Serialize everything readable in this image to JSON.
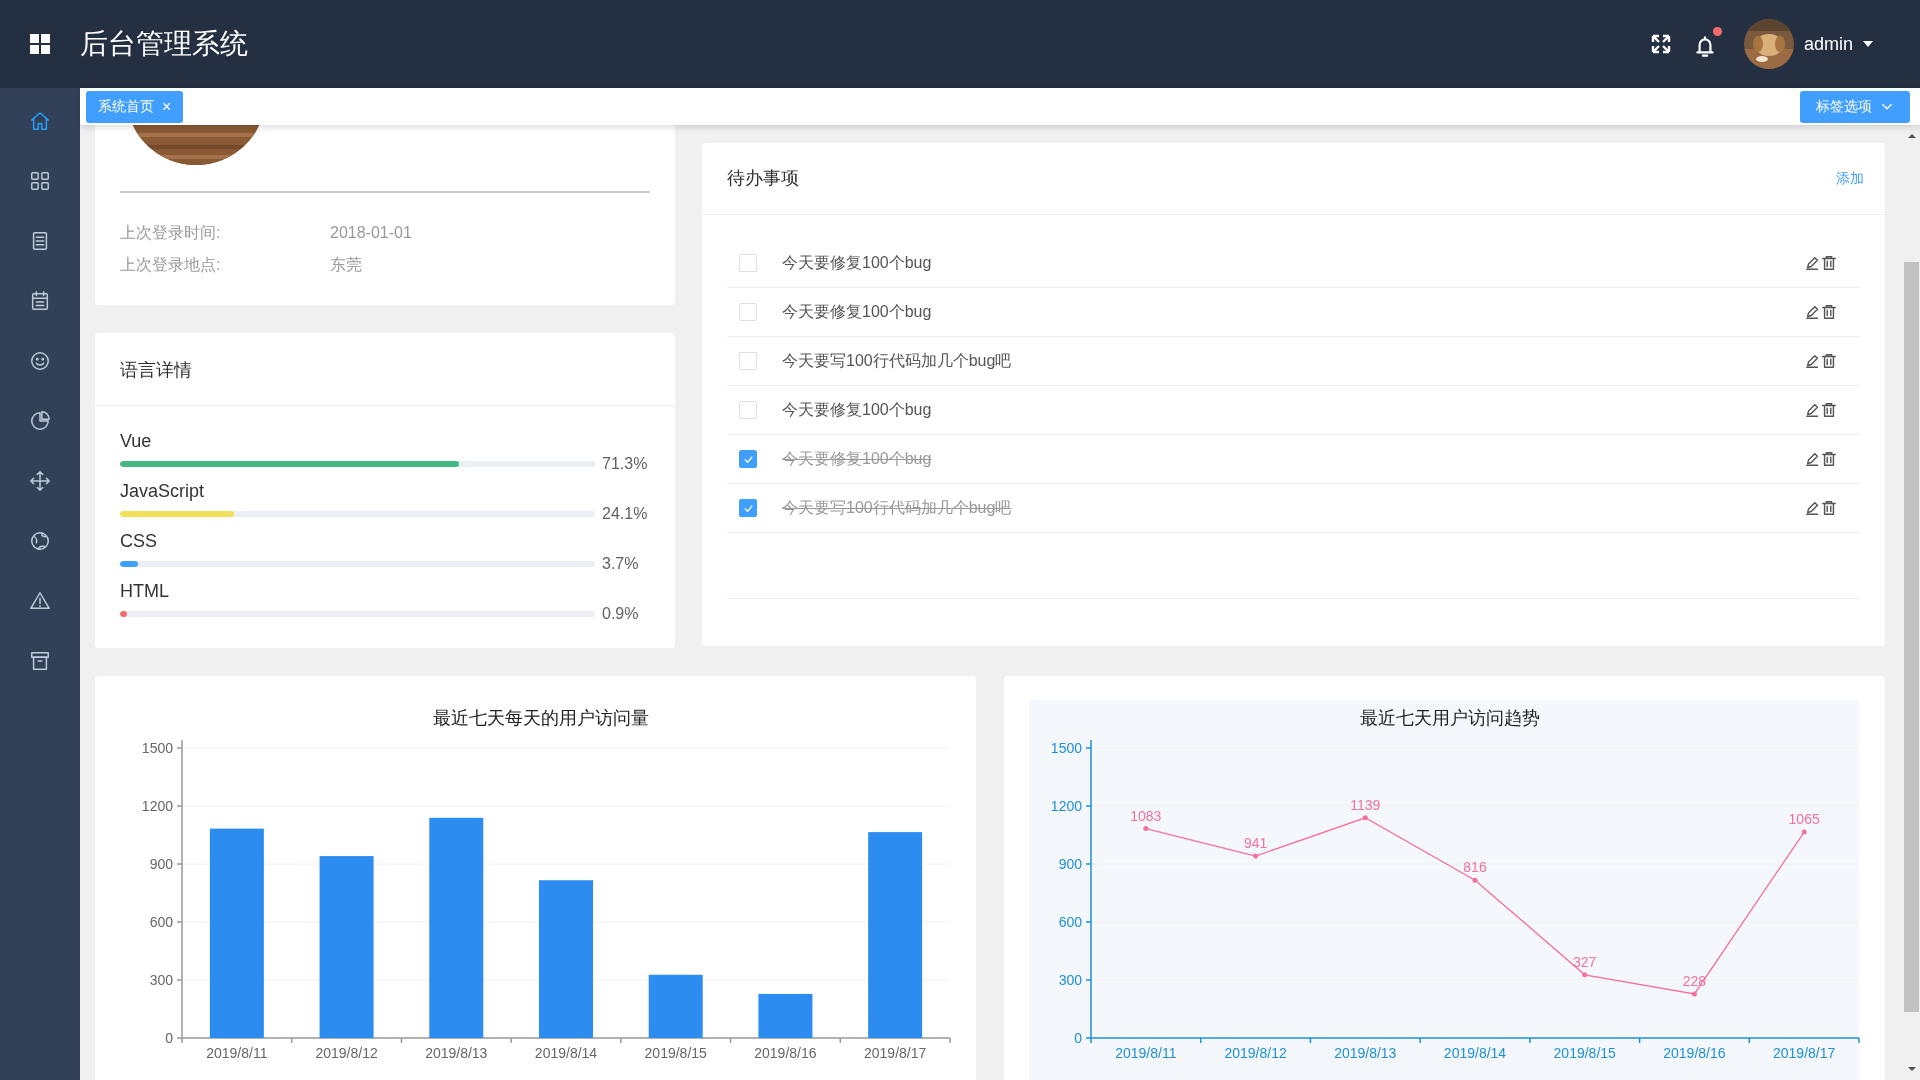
{
  "header": {
    "title": "后台管理系统",
    "notifications": {
      "unread": true
    },
    "user": {
      "name": "admin"
    }
  },
  "sidebar": {
    "items": [
      {
        "selected": true
      },
      {
        "selected": false
      },
      {
        "selected": false
      },
      {
        "selected": false
      },
      {
        "selected": false
      },
      {
        "selected": false
      },
      {
        "selected": false
      },
      {
        "selected": false
      },
      {
        "selected": false
      },
      {
        "selected": false
      }
    ]
  },
  "tags": {
    "items": [
      {
        "label": "系统首页",
        "close": "×",
        "selected": true
      }
    ],
    "options_button": "标签选项"
  },
  "profile": {
    "fields": [
      {
        "label": "上次登录时间:",
        "value": "2018-01-01"
      },
      {
        "label": "上次登录地点:",
        "value": "东莞"
      }
    ]
  },
  "languages": {
    "title": "语言详情",
    "items": [
      {
        "name": "Vue",
        "level": 0.713,
        "reading": "71.3%",
        "color": "#42b983"
      },
      {
        "name": "JavaScript",
        "level": 0.241,
        "reading": "24.1%",
        "color": "#f1e05a"
      },
      {
        "name": "CSS",
        "level": 0.037,
        "reading": "3.7%",
        "color": "#409eff"
      },
      {
        "name": "HTML",
        "level": 0.009,
        "reading": "0.9%",
        "color": "#f56c6c"
      }
    ]
  },
  "todo": {
    "title": "待办事项",
    "add": "添加",
    "items": [
      {
        "text": "今天要修复100个bug",
        "checked": false
      },
      {
        "text": "今天要修复100个bug",
        "checked": false
      },
      {
        "text": "今天要写100行代码加几个bug吧",
        "checked": false
      },
      {
        "text": "今天要修复100个bug",
        "checked": false
      },
      {
        "text": "今天要修复100个bug",
        "checked": true
      },
      {
        "text": "今天要写100行代码加几个bug吧",
        "checked": true
      }
    ]
  },
  "charts": [
    {
      "chart_data": {
        "type": "bar",
        "title": "最近七天每天的用户访问量",
        "categories": [
          "2019/8/11",
          "2019/8/12",
          "2019/8/13",
          "2019/8/14",
          "2019/8/15",
          "2019/8/16",
          "2019/8/17"
        ],
        "series": [
          {
            "color": "#2d8cf0",
            "values": [
              1083,
              941,
              1139,
              816,
              327,
              228,
              1065
            ]
          }
        ],
        "ylim": [
          0,
          1500
        ],
        "yticks": [
          0,
          300,
          600,
          900,
          1200,
          1500
        ],
        "grid": true
      }
    },
    {
      "chart_data": {
        "type": "line",
        "title": "最近七天用户访问趋势",
        "categories": [
          "2019/8/11",
          "2019/8/12",
          "2019/8/13",
          "2019/8/14",
          "2019/8/15",
          "2019/8/16",
          "2019/8/17"
        ],
        "series": [
          {
            "color": "#f56fa0",
            "values": [
              1083,
              941,
              1139,
              816,
              327,
              228,
              1065
            ]
          }
        ],
        "ylim": [
          0,
          1500
        ],
        "yticks": [
          0,
          300,
          600,
          900,
          1200,
          1500
        ],
        "grid": true,
        "data_labels": true
      }
    }
  ]
}
